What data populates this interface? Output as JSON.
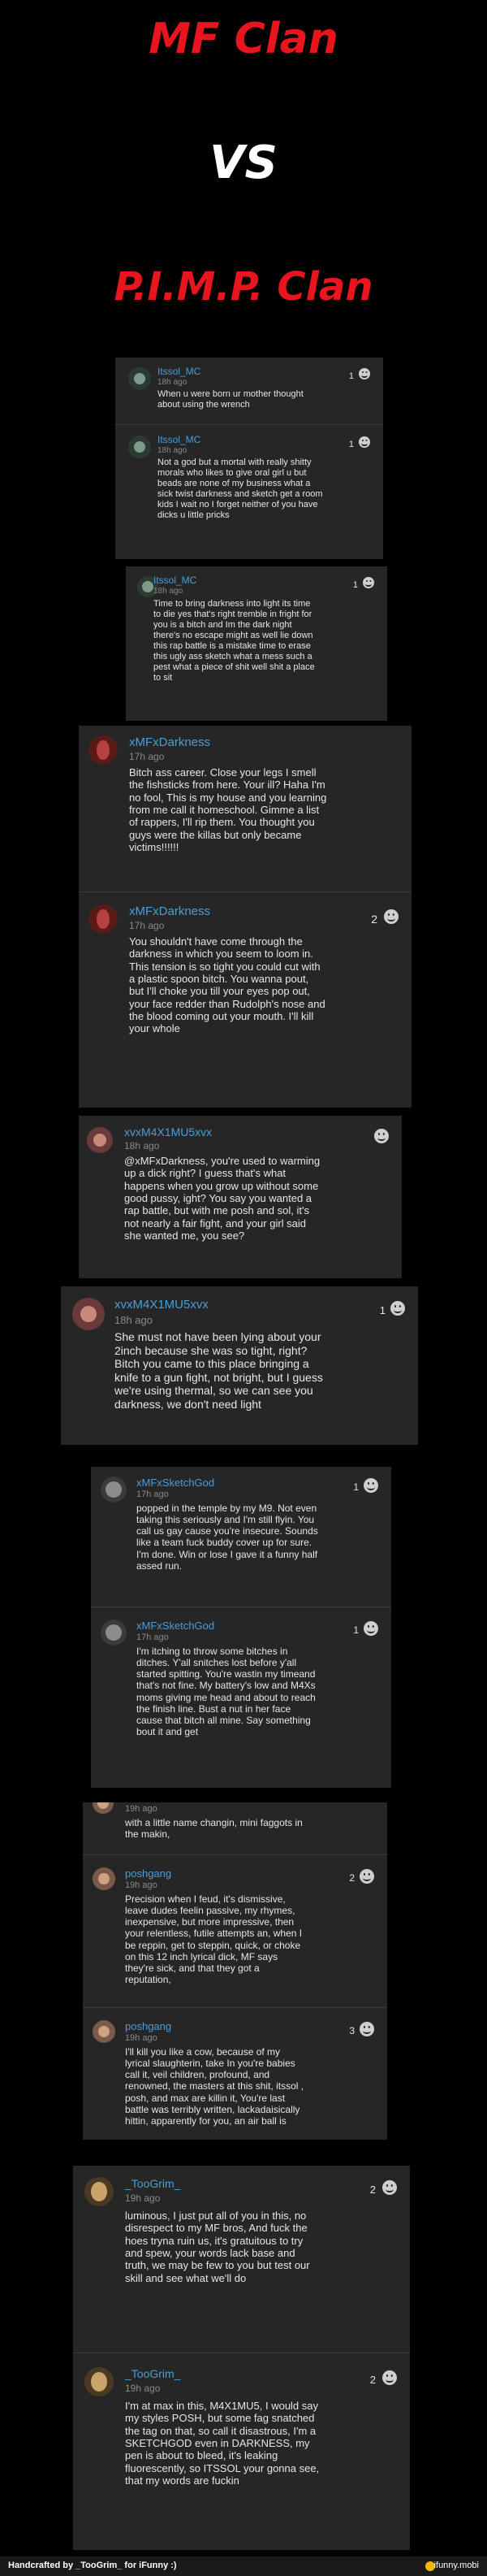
{
  "titles": {
    "line1": "MF Clan",
    "line2": "VS",
    "line3": "P.I.M.P. Clan"
  },
  "comments": [
    {
      "user": "Itssol_MC",
      "time": "18h ago",
      "likes": "1",
      "text": "When u were born ur mother thought\nabout using the wrench"
    },
    {
      "user": "Itssol_MC",
      "time": "18h ago",
      "likes": "1",
      "text": "Not a god but a mortal with really shitty\nmorals who likes to give oral girl u but\nbeads are none of my business what a\nsick twist darkness and sketch get a room\nkids I wait no I forget neither of you have\ndicks u little pricks"
    },
    {
      "user": "Itssol_MC",
      "time": "18h ago",
      "likes": "1",
      "text": "Time to bring darkness into light its time\nto die yes that's right tremble in fright for\nyou is a bitch and Im the dark night\nthere's no escape might as well lie down\nthis rap battle is a mistake time to erase\nthis ugly ass sketch what a mess such a\npest what a piece of shit well shit a place\nto sit"
    },
    {
      "user": "xMFxDarkness",
      "time": "17h ago",
      "likes": "",
      "text": "Bitch ass career. Close your legs I smell\nthe fishsticks from here. Your ill? Haha I'm\nno fool, This is my house and you learning\nfrom me call it homeschool. Gimme a list\nof rappers, I'll rip them. You thought you\nguys were the killas but only became\nvictims!!!!!!"
    },
    {
      "user": "xMFxDarkness",
      "time": "17h ago",
      "likes": "2",
      "text": "You shouldn't have come through the\ndarkness in which you seem to loom in.\nThis tension is so tight you could cut with\na plastic spoon bitch. You wanna pout,\nbut I'll choke you till your eyes pop out,\nyour face redder than Rudolph's nose and\nthe blood coming out your mouth. I'll kill\nyour whole"
    },
    {
      "user": "xvxM4X1MU5xvx",
      "time": "18h ago",
      "likes": "",
      "text": "@xMFxDarkness, you're used to warming\nup a dick right? I guess that's what\nhappens when you grow up without some\ngood pussy, ight? You say you wanted a\nrap battle, but with me posh and sol, it's\nnot nearly a fair fight, and your girl said\nshe wanted me, you see?"
    },
    {
      "user": "xvxM4X1MU5xvx",
      "time": "18h ago",
      "likes": "1",
      "text": "She must not have been lying about your\n2inch because she was so tight, right?\nBitch you came to this place bringing a\nknife to a gun fight, not bright, but I guess\nwe're using thermal, so we can see you\ndarkness, we don't need light"
    },
    {
      "user": "xMFxSketchGod",
      "time": "17h ago",
      "likes": "1",
      "text": "popped in the temple by my M9. Not even\ntaking this seriously and I'm still flyin. You\ncall us gay cause you're insecure. Sounds\nlike a team fuck buddy cover up for sure.\nI'm done. Win or lose I gave it a funny half\nassed run."
    },
    {
      "user": "xMFxSketchGod",
      "time": "17h ago",
      "likes": "1",
      "text": "I'm itching to throw some bitches in\nditches. Y'all snitches lost before y'all\nstarted spitting. You're wastin my timeand\nthat's not fine. My battery's low and M4Xs\nmoms giving me head and about to reach\nthe finish line. Bust a nut in her face\ncause that bitch all mine. Say something\nbout it and get"
    },
    {
      "user": "",
      "time": "19h ago",
      "likes": "",
      "text": "with a little name changin, mini faggots in\nthe makin,"
    },
    {
      "user": "poshgang",
      "time": "19h ago",
      "likes": "2",
      "text": "Precision when I feud, it's dismissive,\nleave dudes feelin passive, my rhymes,\ninexpensive, but more impressive, then\nyour relentless, futile attempts an, when I\nbe reppin, get to steppin, quick, or choke\non this 12 inch lyrical dick, MF says\nthey're sick, and that they got a\nreputation,"
    },
    {
      "user": "poshgang",
      "time": "19h ago",
      "likes": "3",
      "text": "I'll kill you like a cow, because of my\nlyrical slaughterin, take In you're babies\ncall it, veil children, profound, and\nrenowned, the masters at this shit, itssol ,\nposh, and max are killin it, You're last\nbattle was terribly written, lackadaisically\nhittin, apparently for you, an air ball is"
    },
    {
      "user": "_TooGrim_",
      "time": "19h ago",
      "likes": "2",
      "text": "luminous, I just put all of you in this, no\ndisrespect to my MF bros, And fuck the\nhoes tryna ruin us, it's gratuitous to try\nand spew, your words lack base and\ntruth, we may be few to you but test our\nskill and see what we'll do"
    },
    {
      "user": "_TooGrim_",
      "time": "19h ago",
      "likes": "2",
      "text": "I'm at max in this, M4X1MU5, I would say\nmy styles POSH, but some fag snatched\nthe tag on that, so call it disastrous, I'm a\nSKETCHGOD even in DARKNESS, my\npen is about to bleed, it's leaking\nfluorescently, so ITSSOL your gonna see,\nthat my words are fuckin"
    }
  ],
  "footer": {
    "credit": "Handcrafted by _TooGrim_ for iFunny :)",
    "brand": "ifunny.mobi"
  },
  "colors": {
    "background": "#000000",
    "panel": "#262626",
    "title_red": "#e8141e",
    "username": "#4a9fd8",
    "timestamp": "#8a8a8a"
  }
}
